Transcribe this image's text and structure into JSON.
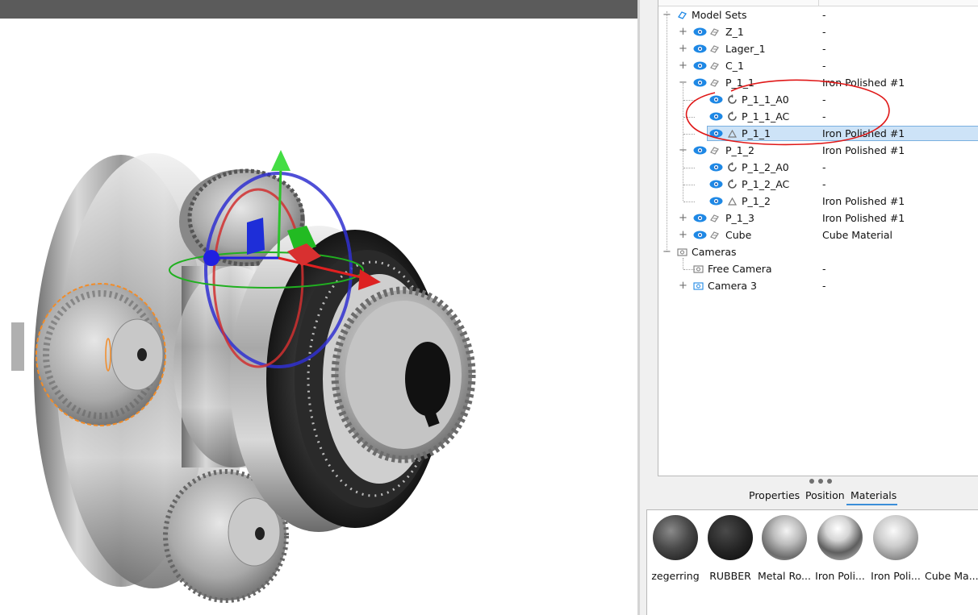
{
  "tree": {
    "rows": [
      {
        "name": "Model Sets",
        "value": "-"
      },
      {
        "name": "Z_1",
        "value": "-"
      },
      {
        "name": "Lager_1",
        "value": "-"
      },
      {
        "name": "C_1",
        "value": "-"
      },
      {
        "name": "P_1_1",
        "value": "Iron Polished #1"
      },
      {
        "name": "P_1_1_A0",
        "value": "-"
      },
      {
        "name": "P_1_1_AC",
        "value": "-"
      },
      {
        "name": "P_1_1",
        "value": "Iron Polished #1"
      },
      {
        "name": "P_1_2",
        "value": "Iron Polished #1"
      },
      {
        "name": "P_1_2_A0",
        "value": "-"
      },
      {
        "name": "P_1_2_AC",
        "value": "-"
      },
      {
        "name": "P_1_2",
        "value": "Iron Polished #1"
      },
      {
        "name": "P_1_3",
        "value": "Iron Polished #1"
      },
      {
        "name": "Cube",
        "value": "Cube Material"
      },
      {
        "name": "Cameras",
        "value": ""
      },
      {
        "name": "Free Camera",
        "value": "-"
      },
      {
        "name": "Camera 3",
        "value": "-"
      }
    ],
    "selected_row": 7
  },
  "tabs": {
    "properties": "Properties",
    "position": "Position",
    "materials": "Materials",
    "active": "materials"
  },
  "materials": [
    {
      "name": "zegerring"
    },
    {
      "name": "RUBBER"
    },
    {
      "name": "Metal Ro..."
    },
    {
      "name": "Iron Poli..."
    },
    {
      "name": "Iron Poli..."
    },
    {
      "name": "Cube Ma..."
    }
  ],
  "colors": {
    "selection": "#cde3f7",
    "eye": "#1e88e5",
    "accent": "#3b8ed8",
    "annotation": "#e01818",
    "outline": "#f28c28"
  }
}
